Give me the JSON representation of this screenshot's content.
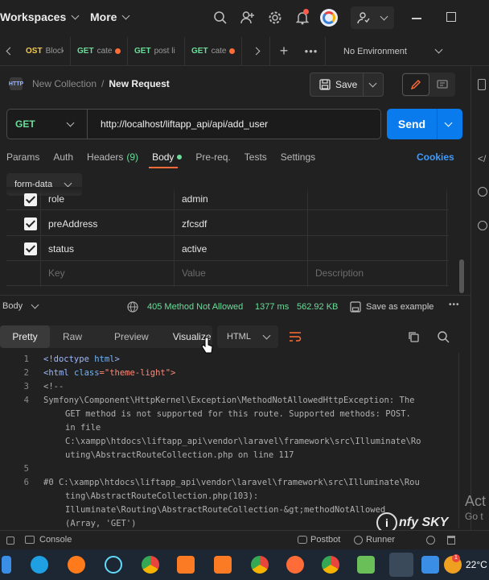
{
  "topbar": {
    "workspaces": "Workspaces",
    "more": "More"
  },
  "tabs": [
    {
      "method": "OST",
      "name": "Block"
    },
    {
      "method": "GET",
      "name": "cate"
    },
    {
      "method": "GET",
      "name": "post li"
    },
    {
      "method": "GET",
      "name": "cate"
    }
  ],
  "environment": "No Environment",
  "breadcrumb": {
    "collection": "New Collection",
    "separator": "/",
    "request": "New Request"
  },
  "save_label": "Save",
  "request": {
    "method": "GET",
    "url": "http://localhost/liftapp_api/api/add_user",
    "send_label": "Send"
  },
  "request_tabs": {
    "params": "Params",
    "auth": "Auth",
    "headers": "Headers",
    "headers_count": "(9)",
    "body": "Body",
    "prereq": "Pre-req.",
    "tests": "Tests",
    "settings": "Settings",
    "cookies": "Cookies"
  },
  "body_mode": "form-data",
  "form_rows": [
    {
      "key": "role",
      "value": "admin"
    },
    {
      "key": "preAddress",
      "value": "zfcsdf"
    },
    {
      "key": "status",
      "value": "active"
    }
  ],
  "form_placeholders": {
    "key": "Key",
    "value": "Value",
    "description": "Description"
  },
  "response": {
    "label": "Body",
    "status": "405 Method Not Allowed",
    "time": "1377 ms",
    "size": "562.92 KB",
    "save_example": "Save as example",
    "tabs": {
      "pretty": "Pretty",
      "raw": "Raw",
      "preview": "Preview",
      "visualize": "Visualize"
    },
    "format": "HTML"
  },
  "code_lines": [
    {
      "n": "1",
      "t1": "<!doctype ",
      "t2": "html",
      "t3": ">"
    },
    {
      "n": "2",
      "t1": "<html ",
      "t2": "class",
      "t3": "=\"theme-light\">"
    },
    {
      "n": "3",
      "t1": "<!--",
      "t2": "",
      "t3": ""
    }
  ],
  "code_text": {
    "l4a": "Symfony\\Component\\HttpKernel\\Exception\\MethodNotAllowedHttpException: The",
    "l4b": "GET method is not supported for this route. Supported methods: POST.",
    "l4c": "in file",
    "l4d": "C:\\xampp\\htdocs\\liftapp_api\\vendor\\laravel\\framework\\src\\Illuminate\\Ro",
    "l4e": "uting\\AbstractRouteCollection.php on line 117",
    "l6a": "#0 C:\\xampp\\htdocs\\liftapp_api\\vendor\\laravel\\framework\\src\\Illuminate\\Rou",
    "l6b": "ting\\AbstractRouteCollection.php(103):",
    "l6c": "Illuminate\\Routing\\AbstractRouteCollection-&gt;methodNotAllowed",
    "l6d": "(Array, 'GET')",
    "n4": "4",
    "n5": "5",
    "n6": "6"
  },
  "footer": {
    "console": "Console",
    "postbot": "Postbot",
    "runner": "Runner"
  },
  "watermark": {
    "act": "Act",
    "goto": "Go t",
    "brand": "nfy SKY"
  },
  "taskbar": {
    "temp": "22°C"
  },
  "colors": {
    "accent": "#ff6c37",
    "send": "#097bed",
    "status": "#6bdd9a"
  }
}
